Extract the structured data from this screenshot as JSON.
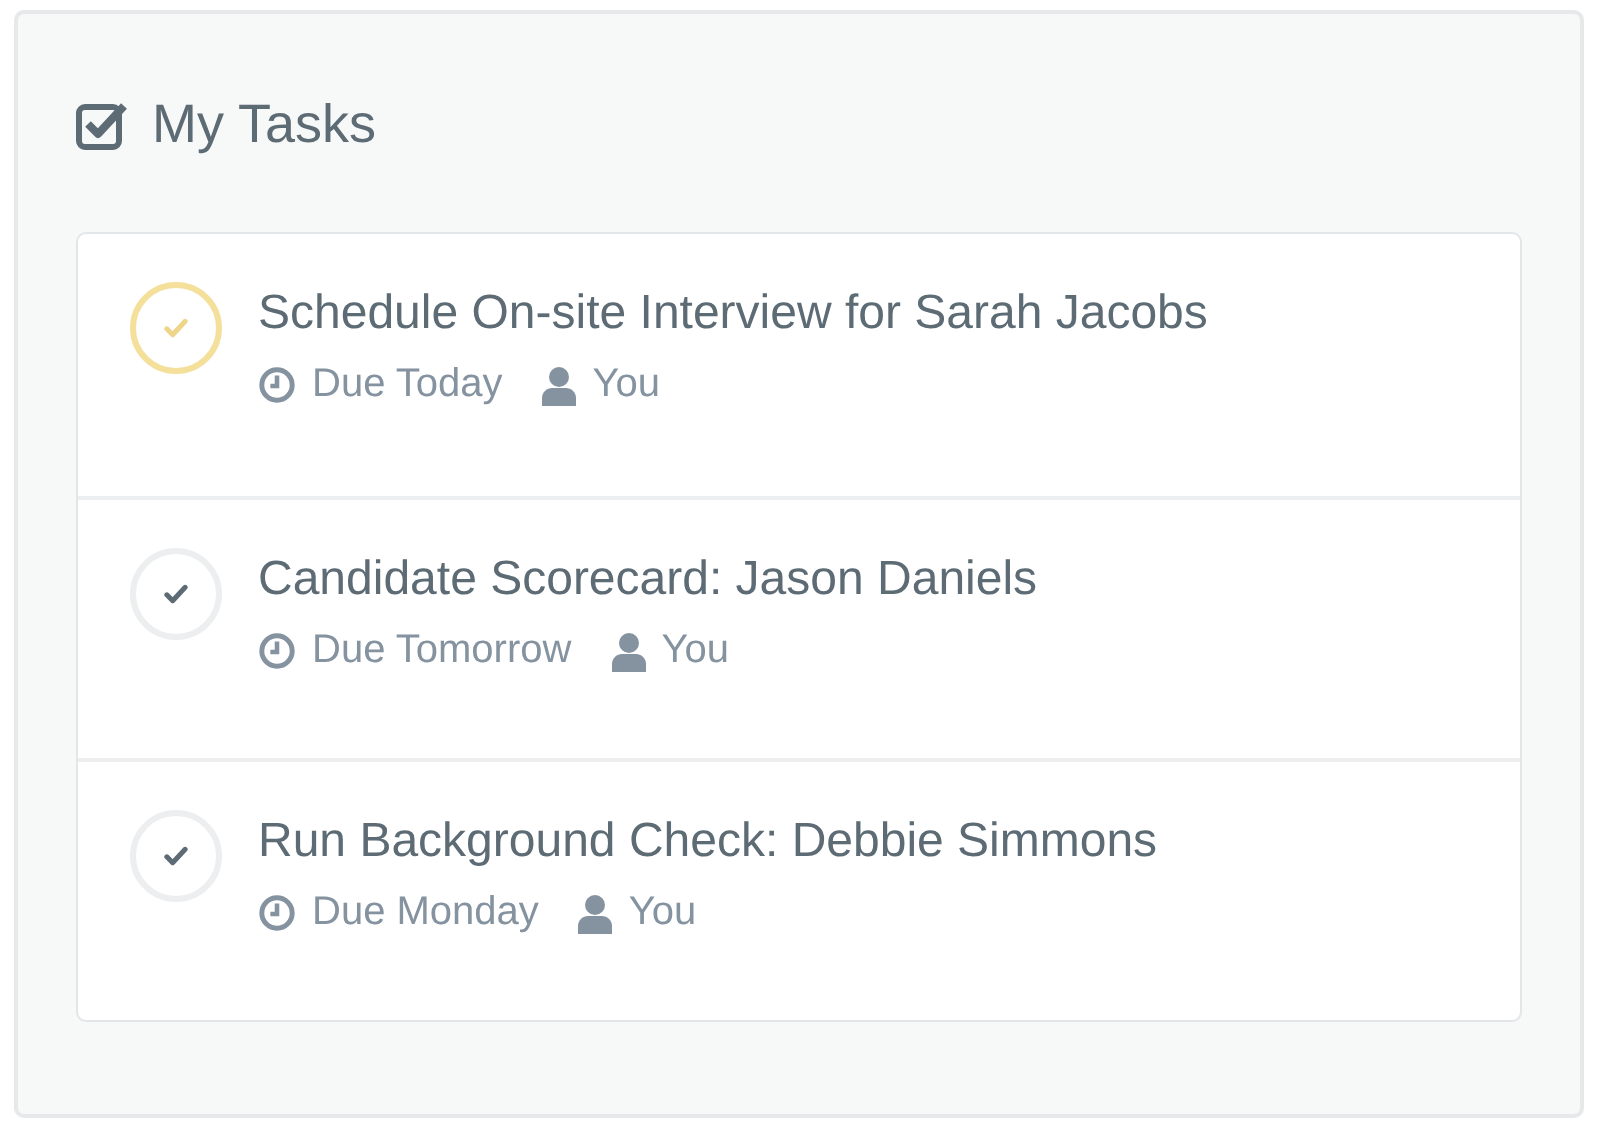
{
  "panel": {
    "title": "My Tasks"
  },
  "tasks": [
    {
      "title": "Schedule On-site Interview for Sarah Jacobs",
      "due": "Due Today",
      "assignee": "You",
      "selected": true
    },
    {
      "title": "Candidate Scorecard: Jason Daniels",
      "due": "Due Tomorrow",
      "assignee": "You",
      "selected": false
    },
    {
      "title": "Run Background Check: Debbie Simmons",
      "due": "Due Monday",
      "assignee": "You",
      "selected": false
    }
  ]
}
